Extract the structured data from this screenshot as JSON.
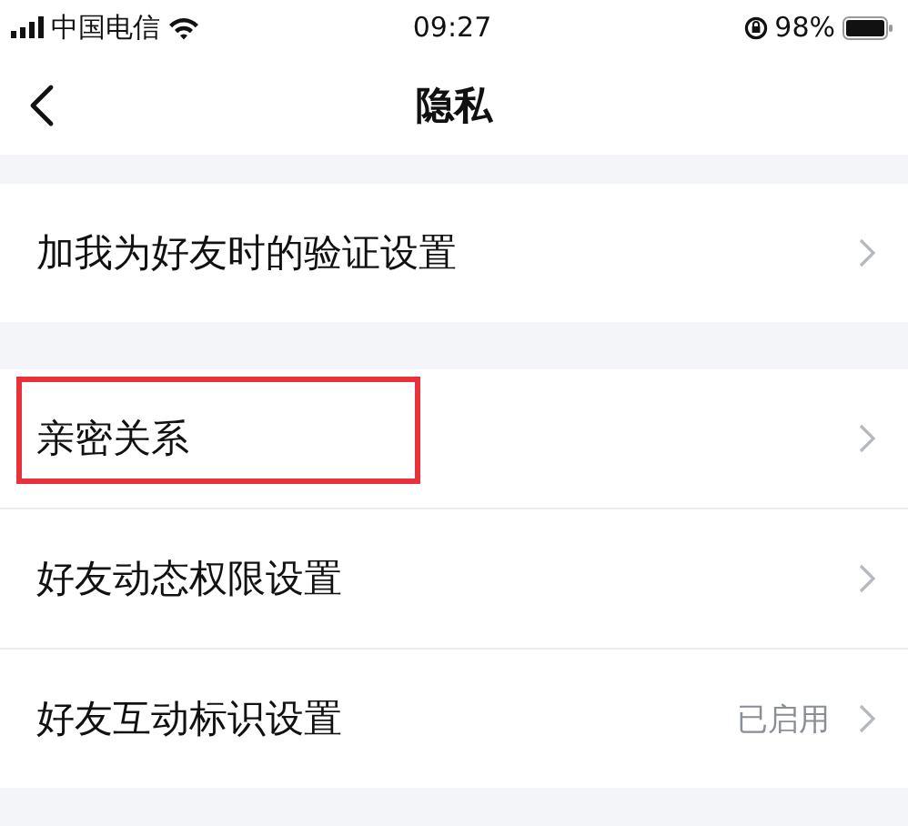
{
  "status_bar": {
    "carrier": "中国电信",
    "time": "09:27",
    "battery": "98%"
  },
  "nav": {
    "title": "隐私"
  },
  "groups": [
    {
      "items": [
        {
          "label": "加我为好友时的验证设置",
          "highlighted": false
        }
      ]
    },
    {
      "items": [
        {
          "label": "亲密关系",
          "highlighted": true
        },
        {
          "label": "好友动态权限设置",
          "highlighted": false
        },
        {
          "label": "好友互动标识设置",
          "value": "已启用",
          "highlighted": false
        }
      ]
    }
  ]
}
